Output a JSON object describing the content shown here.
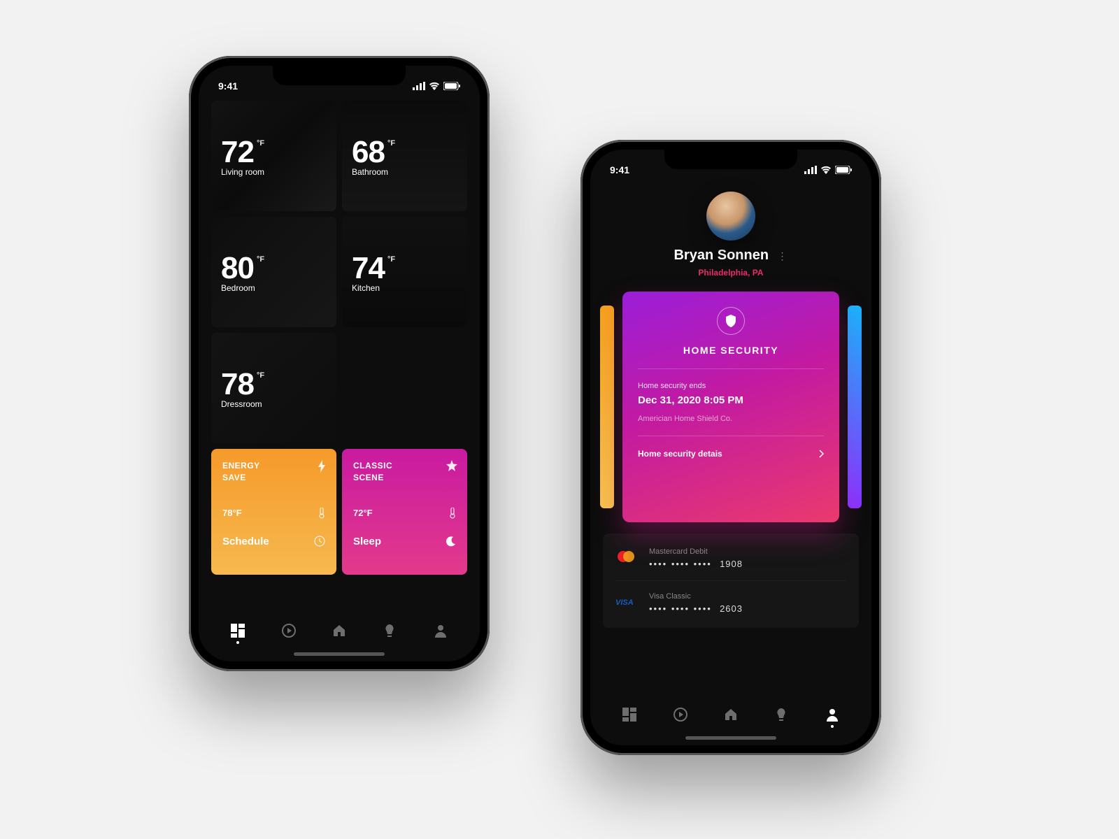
{
  "status": {
    "time": "9:41"
  },
  "rooms": [
    {
      "temp": "72",
      "unit": "°F",
      "name": "Living room"
    },
    {
      "temp": "68",
      "unit": "°F",
      "name": "Bathroom"
    },
    {
      "temp": "80",
      "unit": "°F",
      "name": "Bedroom"
    },
    {
      "temp": "74",
      "unit": "°F",
      "name": "Kitchen"
    },
    {
      "temp": "78",
      "unit": "°F",
      "name": "Dressroom"
    }
  ],
  "scenes": {
    "energy": {
      "title1": "ENERGY",
      "title2": "SAVE",
      "temp": "78°F",
      "action": "Schedule"
    },
    "classic": {
      "title1": "CLASSIC",
      "title2": "SCENE",
      "temp": "72°F",
      "action": "Sleep"
    }
  },
  "profile": {
    "name": "Bryan Sonnen",
    "location": "Philadelphia, PA"
  },
  "security": {
    "title": "HOME SECURITY",
    "ends_label": "Home security ends",
    "ends_value": "Dec 31, 2020 8:05 PM",
    "company": "Americian Home Shield Co.",
    "link": "Home security detais"
  },
  "payments": [
    {
      "brand": "Mastercard",
      "label": "Mastercard Debit",
      "mask": "•••• •••• ••••",
      "last": "1908"
    },
    {
      "brand": "Visa",
      "label": "Visa Classic",
      "mask": "•••• •••• ••••",
      "last": "2603"
    }
  ]
}
